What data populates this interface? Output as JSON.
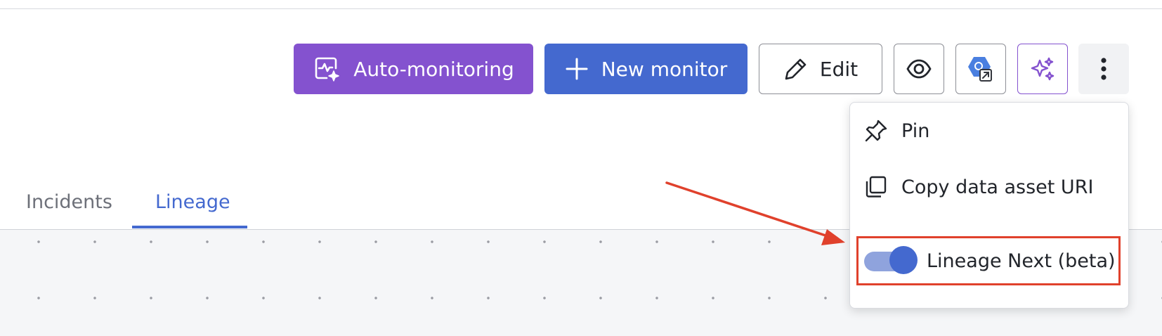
{
  "toolbar": {
    "auto_monitoring_label": "Auto-monitoring",
    "new_monitor_label": "New monitor",
    "edit_label": "Edit",
    "icons": {
      "auto_monitoring": "monitor-sparkle-icon",
      "new_monitor": "plus-icon",
      "edit": "pencil-icon",
      "view": "eye-icon",
      "bigquery": "bigquery-external-link-icon",
      "ai": "sparkles-icon",
      "more": "more-vertical-icon"
    }
  },
  "tabs": [
    {
      "label": "Incidents",
      "active": false
    },
    {
      "label": "Lineage",
      "active": true
    }
  ],
  "menu": {
    "items": [
      {
        "label": "Pin",
        "icon": "pin-icon"
      },
      {
        "label": "Copy data asset URI",
        "icon": "copy-icon"
      },
      {
        "label": "Lineage Next (beta)",
        "icon": "toggle-switch",
        "toggled": true
      }
    ]
  },
  "colors": {
    "purple": "#8452cf",
    "blue": "#4469cf",
    "annotation_red": "#e0412c",
    "canvas_bg": "#f5f6f8"
  }
}
